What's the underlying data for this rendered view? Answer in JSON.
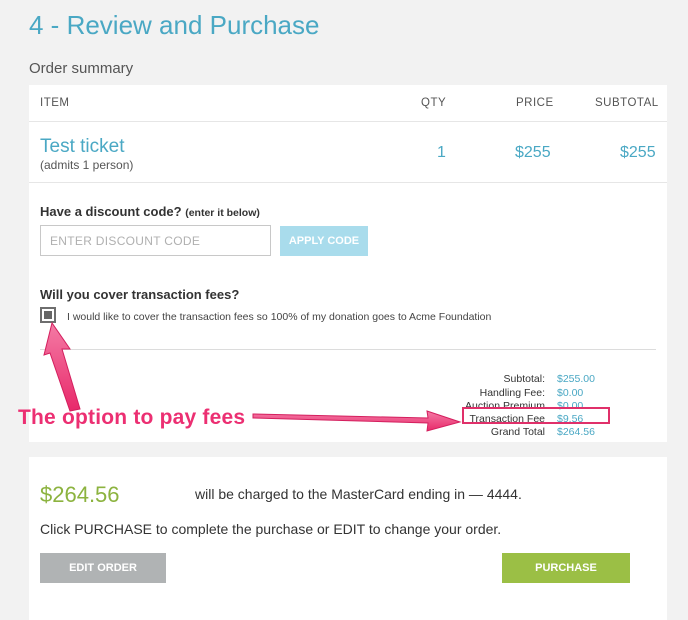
{
  "page": {
    "title": "4 - Review and Purchase",
    "section": "Order summary"
  },
  "table": {
    "headers": {
      "item": "ITEM",
      "qty": "QTY",
      "price": "PRICE",
      "subtotal": "SUBTOTAL"
    },
    "rows": [
      {
        "name": "Test ticket",
        "subtitle": "(admits 1 person)",
        "qty": "1",
        "price": "$255",
        "subtotal": "$255"
      }
    ]
  },
  "discount": {
    "label": "Have a discount code?",
    "hint": "(enter it below)",
    "placeholder": "ENTER DISCOUNT CODE",
    "apply_label": "APPLY CODE"
  },
  "fees": {
    "question": "Will you cover transaction fees?",
    "checkbox_label": "I would like to cover the transaction fees so 100% of my donation goes to Acme Foundation",
    "checked": true
  },
  "totals": {
    "subtotal_label": "Subtotal:",
    "subtotal": "$255.00",
    "handling_label": "Handling Fee:",
    "handling": "$0.00",
    "auction_label": "Auction Premium",
    "auction": "$0.00",
    "transaction_label": "Transaction Fee",
    "transaction": "$9.56",
    "grand_label": "Grand Total",
    "grand": "$264.56"
  },
  "charge": {
    "amount": "$264.56",
    "text": "will be charged to the MasterCard ending in — 4444.",
    "note": "Click PURCHASE to complete the purchase or EDIT to change your order.",
    "edit_label": "EDIT ORDER",
    "purchase_label": "PURCHASE"
  },
  "annotation": {
    "text": "The option to pay fees"
  },
  "colors": {
    "accent": "#4aa8c4",
    "amount_green": "#8cb33f",
    "purchase_button": "#9bbf45",
    "edit_button": "#b0b3b4",
    "apply_button": "#a9dcec",
    "annotation_pink": "#ec2f72"
  }
}
